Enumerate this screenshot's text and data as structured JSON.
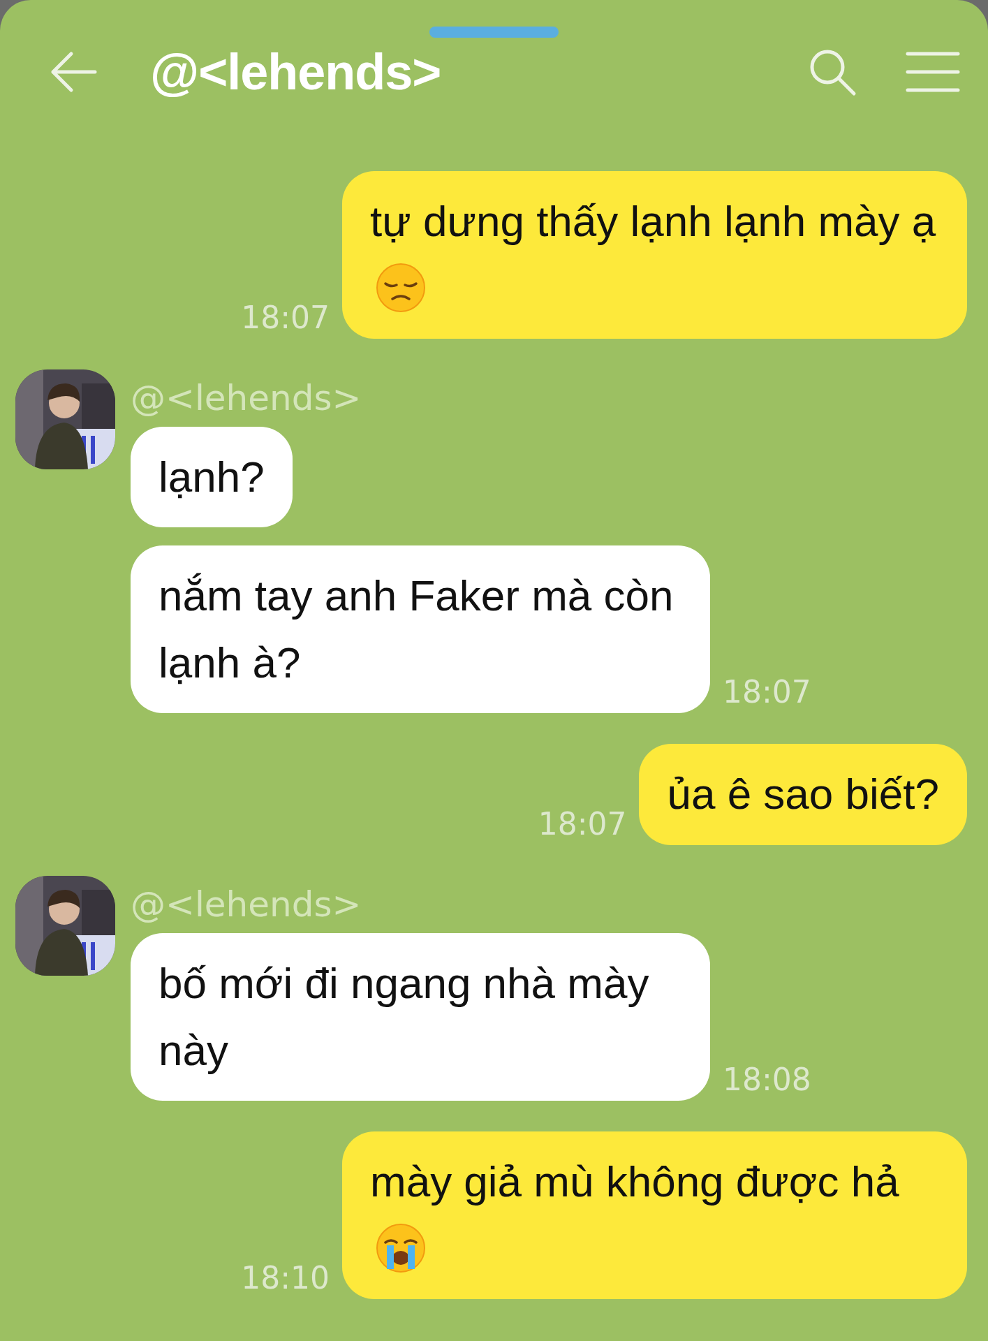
{
  "header": {
    "title": "@<lehends>"
  },
  "messages": [
    {
      "kind": "sent",
      "text": "tự dưng thấy lạnh lạnh mày ạ",
      "emoji": {
        "kind": "disappointed"
      },
      "time": "18:07"
    },
    {
      "kind": "received",
      "sender": "@<lehends>",
      "bubbles": [
        {
          "text": "lạnh?"
        },
        {
          "text": "nắm tay anh Faker mà còn lạnh à?",
          "time": "18:07"
        }
      ]
    },
    {
      "kind": "sent",
      "text": "ủa ê sao biết?",
      "time": "18:07"
    },
    {
      "kind": "received",
      "sender": "@<lehends>",
      "bubbles": [
        {
          "text": "bố mới đi ngang nhà mày này",
          "time": "18:08"
        }
      ]
    },
    {
      "kind": "sent",
      "text": "mày giả mù không được hả",
      "emoji": {
        "kind": "crying"
      },
      "time": "18:10"
    }
  ]
}
